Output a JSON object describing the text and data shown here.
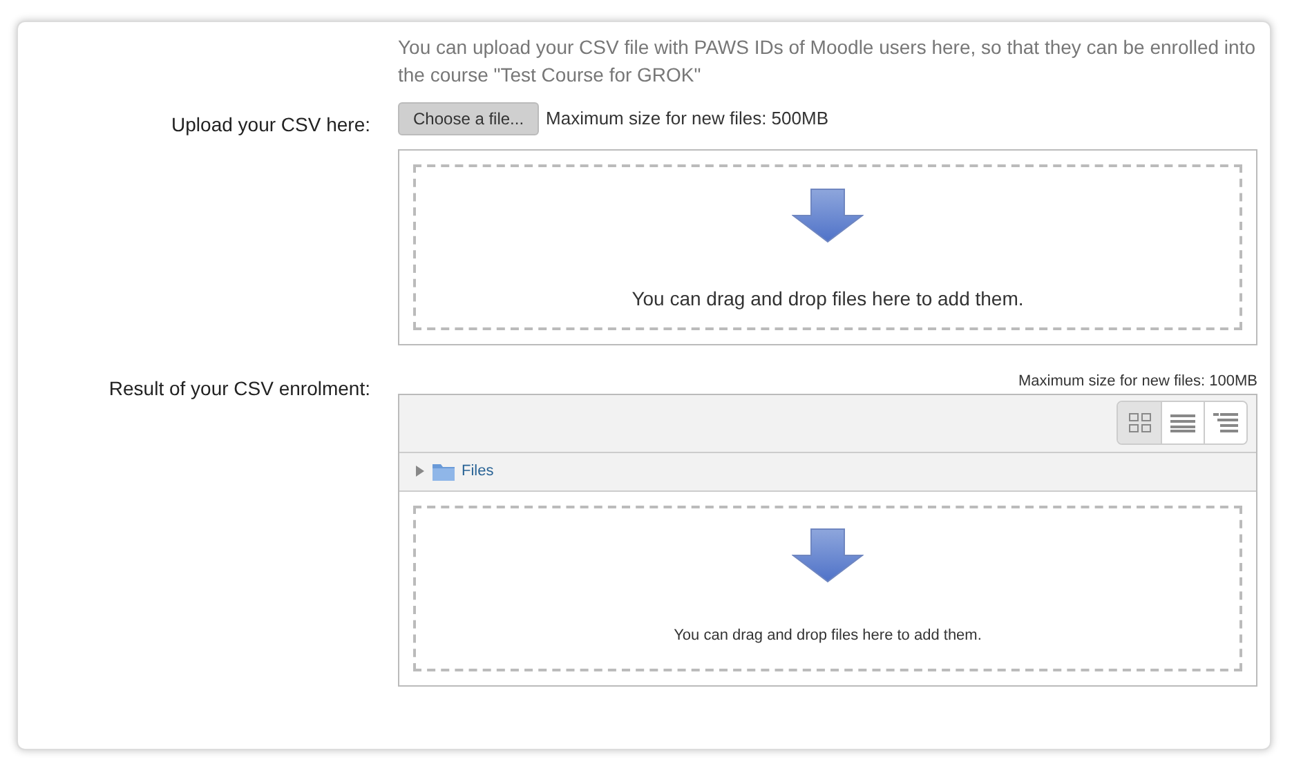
{
  "intro": "You can upload your CSV file with PAWS IDs of Moodle users here, so that they can be enrolled into the course \"Test Course for GROK\"",
  "upload": {
    "label": "Upload your CSV here:",
    "button": "Choose a file...",
    "max_size": "Maximum size for new files: 500MB",
    "drop_text": "You can drag and drop files here to add them."
  },
  "result": {
    "label": "Result of your CSV enrolment:",
    "max_size": "Maximum size for new files: 100MB",
    "view_buttons": [
      {
        "kind": "icons",
        "selected": true
      },
      {
        "kind": "list",
        "selected": false
      },
      {
        "kind": "tree",
        "selected": false
      }
    ],
    "folder": {
      "name": "Files",
      "expanded": false
    },
    "drop_text": "You can drag and drop files here to add them."
  }
}
